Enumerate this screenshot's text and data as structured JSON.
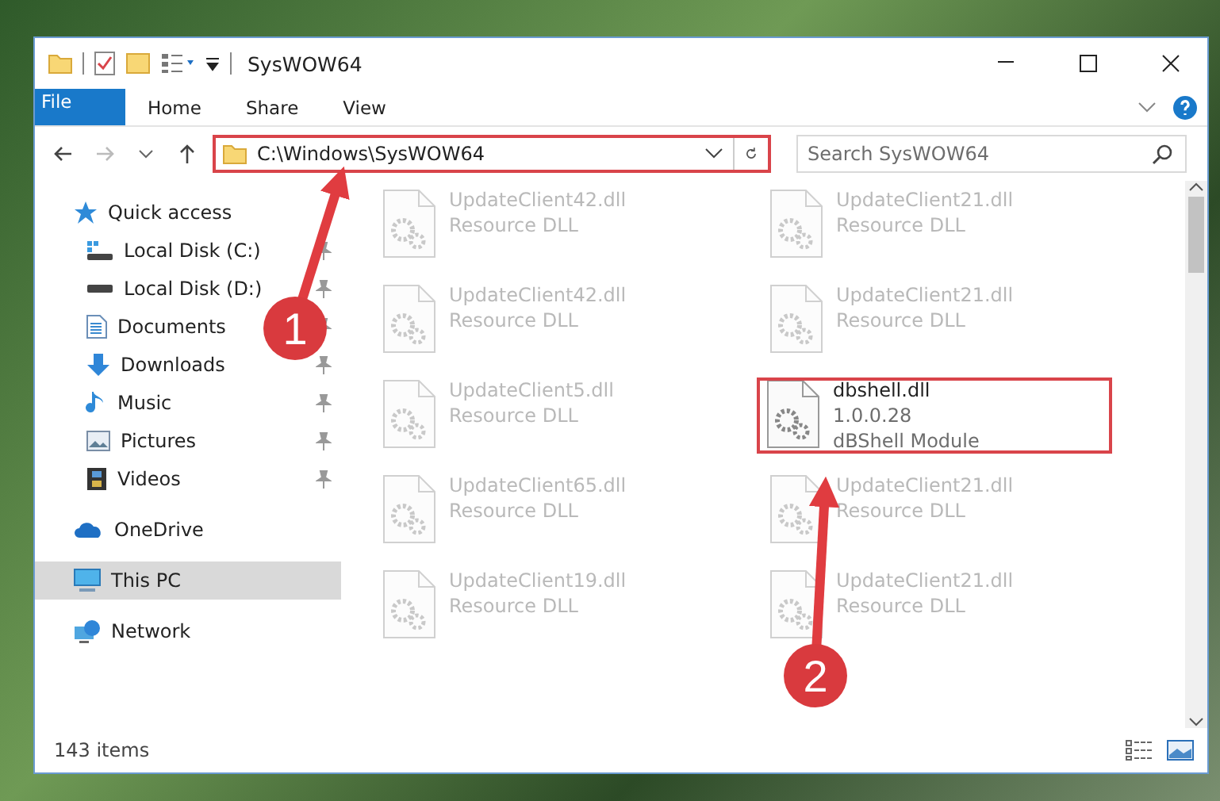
{
  "window": {
    "title": "SysWOW64"
  },
  "ribbon_tabs": [
    {
      "label": "File",
      "kind": "file"
    },
    {
      "label": "Home",
      "kind": "tab"
    },
    {
      "label": "Share",
      "kind": "tab"
    },
    {
      "label": "View",
      "kind": "tab"
    }
  ],
  "address_bar": {
    "path": "C:\\Windows\\SysWOW64",
    "highlighted": true
  },
  "search": {
    "placeholder": "Search SysWOW64"
  },
  "sidebar": {
    "items": [
      {
        "label": "Quick access",
        "selected": false,
        "children": [
          {
            "label": "Local Disk (C:)",
            "pinned": true,
            "selected": false
          },
          {
            "label": "Local Disk (D:)",
            "pinned": true,
            "selected": false
          },
          {
            "label": "Documents",
            "pinned": true,
            "selected": false
          },
          {
            "label": "Downloads",
            "pinned": true,
            "selected": false
          },
          {
            "label": "Music",
            "pinned": true,
            "selected": false
          },
          {
            "label": "Pictures",
            "pinned": true,
            "selected": false
          },
          {
            "label": "Videos",
            "pinned": true,
            "selected": false
          }
        ]
      },
      {
        "label": "OneDrive",
        "selected": false
      },
      {
        "label": "This PC",
        "selected": true
      },
      {
        "label": "Network",
        "selected": false
      }
    ]
  },
  "files": [
    {
      "name": "UpdateClient42.dll",
      "details": [
        "Resource DLL"
      ],
      "kind": "blurred",
      "highlighted": false
    },
    {
      "name": "UpdateClient21.dll",
      "details": [
        "Resource DLL"
      ],
      "kind": "blurred",
      "highlighted": false
    },
    {
      "name": "UpdateClient42.dll",
      "details": [
        "Resource DLL"
      ],
      "kind": "blurred",
      "highlighted": false
    },
    {
      "name": "UpdateClient21.dll",
      "details": [
        "Resource DLL"
      ],
      "kind": "blurred",
      "highlighted": false
    },
    {
      "name": "UpdateClient5.dll",
      "details": [
        "Resource DLL"
      ],
      "kind": "blurred",
      "highlighted": false
    },
    {
      "name": "dbshell.dll",
      "details": [
        "1.0.0.28",
        "dBShell Module"
      ],
      "kind": "normal",
      "highlighted": true
    },
    {
      "name": "UpdateClient65.dll",
      "details": [
        "Resource DLL"
      ],
      "kind": "blurred",
      "highlighted": false
    },
    {
      "name": "UpdateClient21.dll",
      "details": [
        "Resource DLL"
      ],
      "kind": "blurred",
      "highlighted": false
    },
    {
      "name": "UpdateClient19.dll",
      "details": [
        "Resource DLL"
      ],
      "kind": "blurred",
      "highlighted": false
    },
    {
      "name": "UpdateClient21.dll",
      "details": [
        "Resource DLL"
      ],
      "kind": "blurred",
      "highlighted": false
    }
  ],
  "status_bar": {
    "item_count": "143 items"
  },
  "annotations": [
    {
      "label": "1"
    },
    {
      "label": "2"
    }
  ]
}
